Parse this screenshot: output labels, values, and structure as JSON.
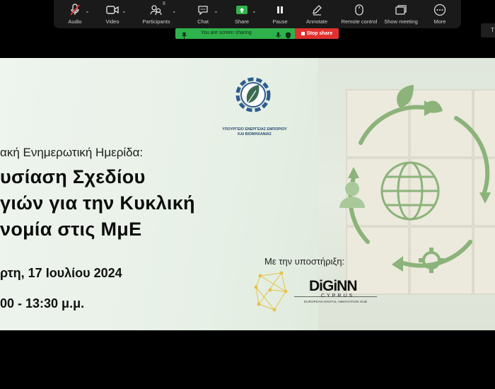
{
  "toolbar": {
    "audio": "Audio",
    "video": "Video",
    "participants": "Participants",
    "participants_count": "8",
    "chat": "Chat",
    "share": "Share",
    "pause": "Pause",
    "annotate": "Annotate",
    "remote_control": "Remote control",
    "show_meeting": "Show meeting",
    "more": "More"
  },
  "sharing_bar": {
    "text": "You are screen sharing",
    "stop": "Stop share"
  },
  "side_tab": "T",
  "slide": {
    "ministry_name": "ΥΠΟΥΡΓΕΙΟ ΕΝΕΡΓΕΙΑΣ ΕΜΠΟΡΙΟΥ ΚΑΙ ΒΙΟΜΗΧΑΝΙΑΣ",
    "subtitle": "ακή Ενημερωτική Ημερίδα:",
    "title_line1": "υσίαση Σχεδίου",
    "title_line2": "γιών για την Κυκλική",
    "title_line3": "νομία στις ΜμΕ",
    "date": "ρτη, 17 Ιουλίου 2024",
    "time": "00 - 13:30 μ.μ.",
    "support_label": "Με την υποστήριξη:",
    "partner_logo": "DiGiNN",
    "partner_sub": "CYPRUS",
    "partner_tag": "EUROPEAN DIGITAL INNOVATION HUB"
  },
  "colors": {
    "toolbar_bg": "#1a1a1a",
    "share_green": "#2fb24c",
    "stop_red": "#e0312f",
    "slide_bg": "#e7f0e6",
    "eco_green": "#7fae6a"
  }
}
